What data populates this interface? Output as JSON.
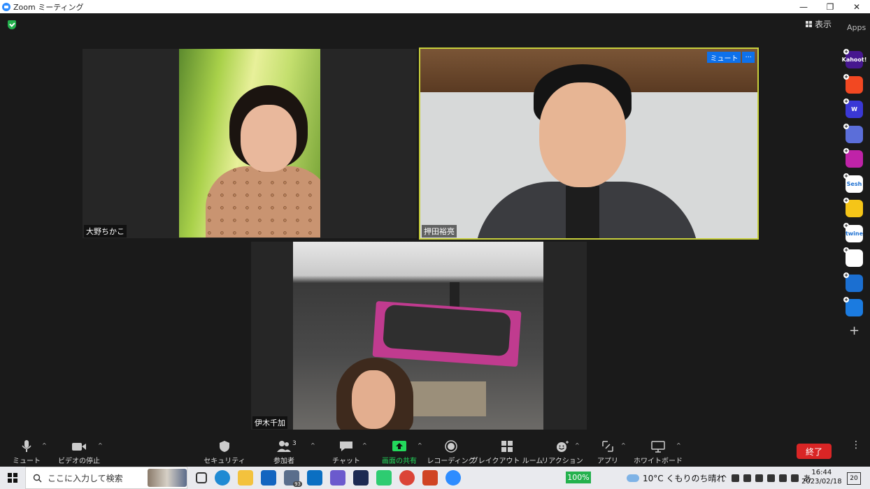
{
  "window": {
    "title": "Zoom ミーティング"
  },
  "header": {
    "view_label": "表示",
    "apps_label": "Apps"
  },
  "participants": [
    {
      "name": "大野ちかこ"
    },
    {
      "name": "押田裕亮",
      "mute_label": "ミュート",
      "more_label": "···"
    },
    {
      "name": "伊木千加"
    }
  ],
  "apps": [
    {
      "name": "Kahoot!",
      "label": "Kahoot!",
      "color": "#46178f"
    },
    {
      "name": "app-2",
      "label": "",
      "color": "#f24822"
    },
    {
      "name": "Wooclap",
      "label": "W",
      "color": "#3a38d6"
    },
    {
      "name": "app-4",
      "label": "",
      "color": "#5b6ed9"
    },
    {
      "name": "app-5",
      "label": "",
      "color": "#c023a8"
    },
    {
      "name": "Sesh",
      "label": "Sesh",
      "color": "#ffffff"
    },
    {
      "name": "app-7",
      "label": "",
      "color": "#f5c518"
    },
    {
      "name": "twine",
      "label": "twine",
      "color": "#ffffff"
    },
    {
      "name": "app-9",
      "label": "",
      "color": "#ffffff"
    },
    {
      "name": "app-10",
      "label": "",
      "color": "#1b6fd1"
    },
    {
      "name": "app-11",
      "label": "",
      "color": "#1b7be0"
    }
  ],
  "toolbar": {
    "mute": "ミュート",
    "video": "ビデオの停止",
    "security": "セキュリティ",
    "participants": "参加者",
    "participants_count": "3",
    "chat": "チャット",
    "share": "画面の共有",
    "record": "レコーディング",
    "breakout": "ブレイクアウト ルーム",
    "reactions": "リアクション",
    "apps": "アプリ",
    "whiteboard": "ホワイトボード",
    "end": "終了"
  },
  "taskbar": {
    "search_placeholder": "ここに入力して検索",
    "mail_badge": "93",
    "zoom_level": "100%",
    "weather": "10°C くもりのち晴れ",
    "ime": "あ",
    "time": "16:44",
    "date": "2023/02/18",
    "notifications": "20"
  }
}
